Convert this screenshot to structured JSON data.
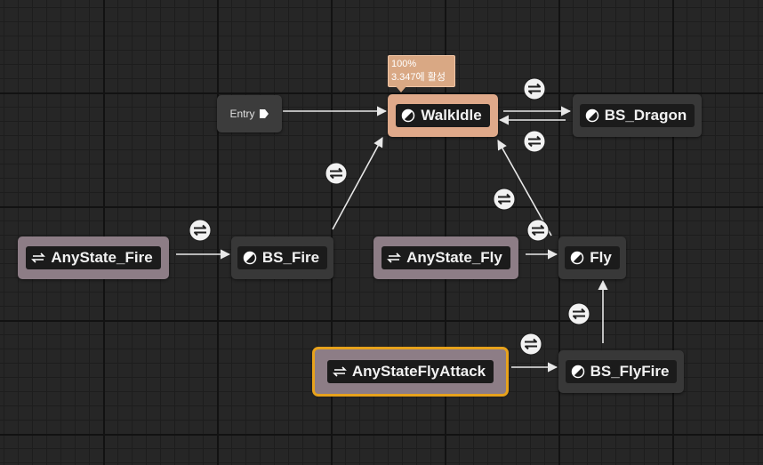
{
  "graph": {
    "entry_label": "Entry",
    "tooltip": {
      "percent": "100%",
      "active_text": "3.347에 활성"
    },
    "states": {
      "walk_idle": "WalkIdle",
      "bs_dragon": "BS_Dragon",
      "bs_fire": "BS_Fire",
      "fly": "Fly",
      "bs_flyfire": "BS_FlyFire"
    },
    "conduits": {
      "anystate_fire": "AnyState_Fire",
      "anystate_fly": "AnyState_Fly",
      "anystate_flyattack": "AnyStateFlyAttack"
    }
  },
  "colors": {
    "background": "#262626",
    "state_node": "#383838",
    "conduit_node": "#8d7d86",
    "active_node": "#dfa98a",
    "selected_outline": "#e7a21c",
    "wire": "#e8e8e8"
  },
  "icons": {
    "state": "half-circle-icon",
    "conduit": "conduit-arrows-icon",
    "transition": "transition-arrows-icon",
    "entry": "entry-arrow-icon"
  }
}
